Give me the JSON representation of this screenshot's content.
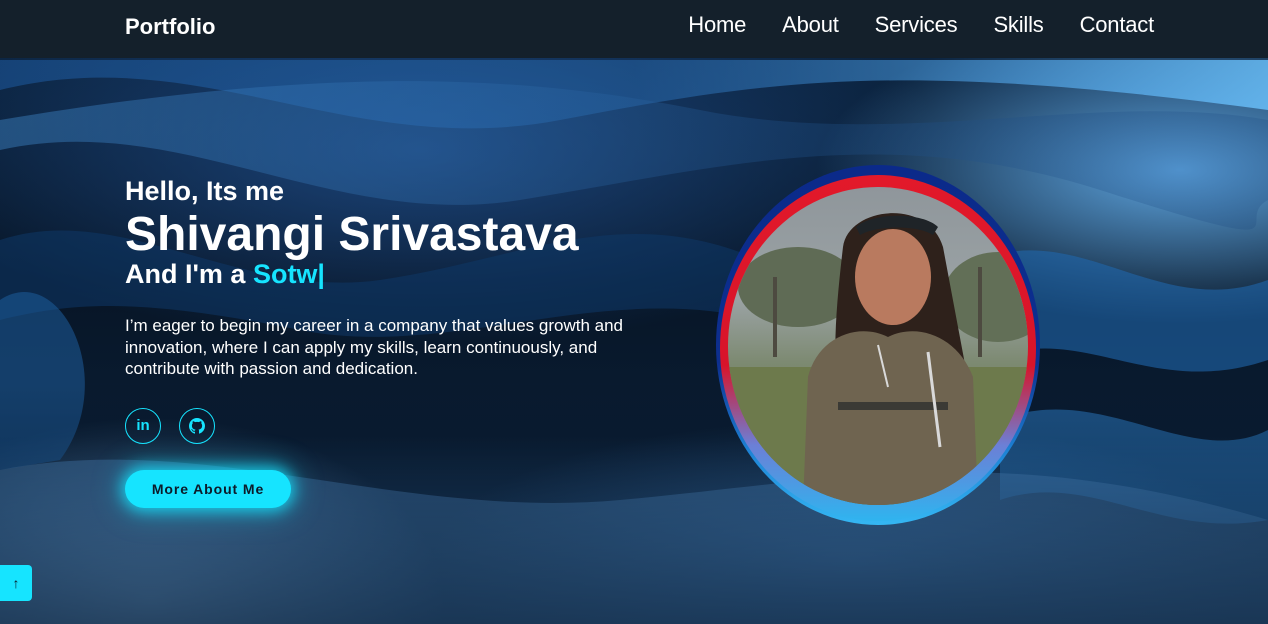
{
  "nav": {
    "logo": "Portfolio",
    "links": [
      "Home",
      "About",
      "Services",
      "Skills",
      "Contact"
    ]
  },
  "hero": {
    "greeting": "Hello, Its me",
    "name": "Shivangi Srivastava",
    "role_prefix": "And I'm a ",
    "role_typed": "Sotw|",
    "intro": "I’m eager to begin my career in a company that values growth and innovation, where I can apply my skills, learn continuously, and contribute with passion and dedication.",
    "socials": [
      {
        "icon": "linkedin-icon",
        "glyph": "in"
      },
      {
        "icon": "github-icon",
        "glyph": ""
      }
    ],
    "cta_label": "More About Me"
  },
  "profile_photo": {
    "alt": "Shivangi Srivastava"
  },
  "back_to_top": {
    "icon": "arrow-up-icon",
    "glyph": "↑"
  },
  "colors": {
    "accent": "#16e4ff",
    "navbar": "#14202b",
    "text": "#ffffff"
  }
}
